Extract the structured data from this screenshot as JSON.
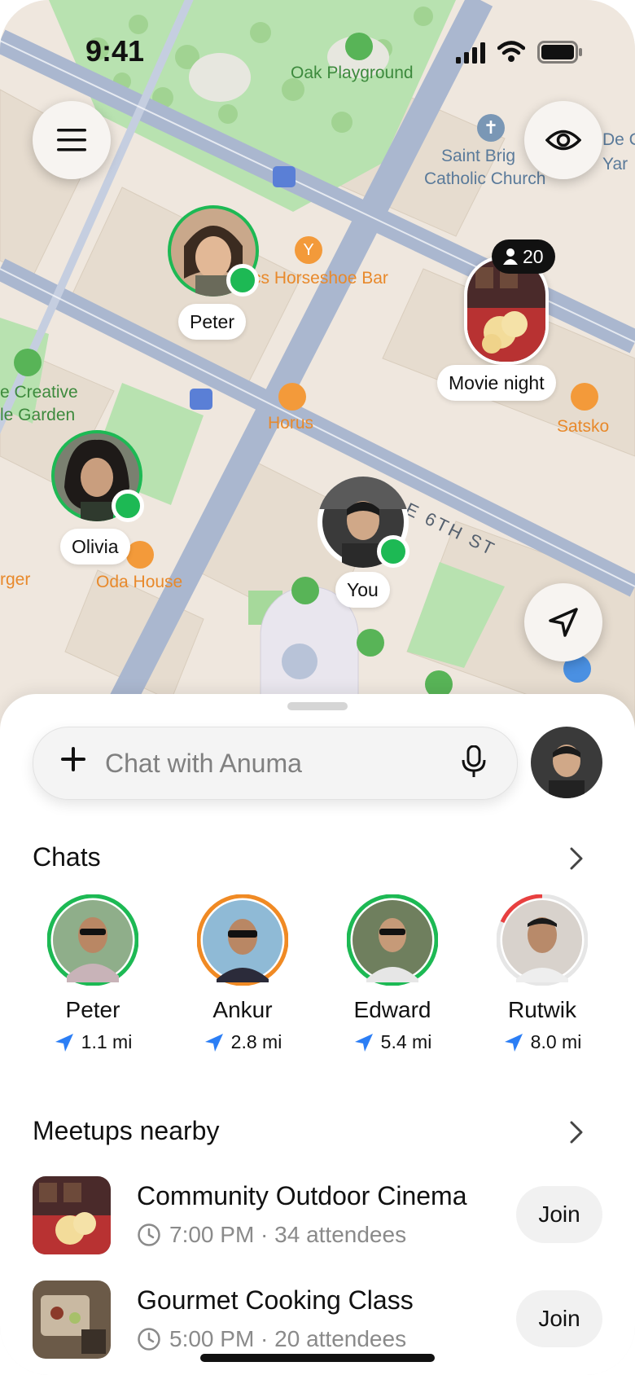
{
  "status_bar": {
    "time": "9:41"
  },
  "map": {
    "places": {
      "oak_playground": "Oak Playground",
      "saint_brigid": "Saint Brig",
      "catholic_church": "Catholic Church",
      "de_partial": "De C",
      "yard_partial": "Yar",
      "horseshoe_bar": "cs Horseshoe Bar",
      "creative_partial": "e Creative",
      "garden_partial": "le Garden",
      "horus": "Horus",
      "satsko": "Satsko",
      "street": "E 6TH ST",
      "burger_partial": "rger",
      "oda_house": "Oda House"
    },
    "pins": {
      "peter": "Peter",
      "olivia": "Olivia",
      "you": "You",
      "movie_night": "Movie night",
      "movie_night_count": "20"
    }
  },
  "sheet": {
    "chat_placeholder": "Chat with Anuma",
    "chats_title": "Chats",
    "friends": [
      {
        "name": "Peter",
        "distance": "1.1 mi",
        "ring_color": "#1db954"
      },
      {
        "name": "Ankur",
        "distance": "2.8 mi",
        "ring_color": "#f08a24"
      },
      {
        "name": "Edward",
        "distance": "5.4 mi",
        "ring_color": "#1db954"
      },
      {
        "name": "Rutwik",
        "distance": "8.0 mi",
        "ring_color": "#e84040"
      }
    ],
    "meetups_title": "Meetups nearby",
    "meetups": [
      {
        "title": "Community Outdoor Cinema",
        "meta": "7:00 PM · 34 attendees",
        "join": "Join"
      },
      {
        "title": "Gourmet Cooking Class",
        "meta": "5:00 PM · 20 attendees",
        "join": "Join"
      }
    ]
  },
  "colors": {
    "accent_blue": "#2b7ef5",
    "online_green": "#1db954",
    "map_road": "#aab7cf",
    "park": "#b8e2b0"
  }
}
